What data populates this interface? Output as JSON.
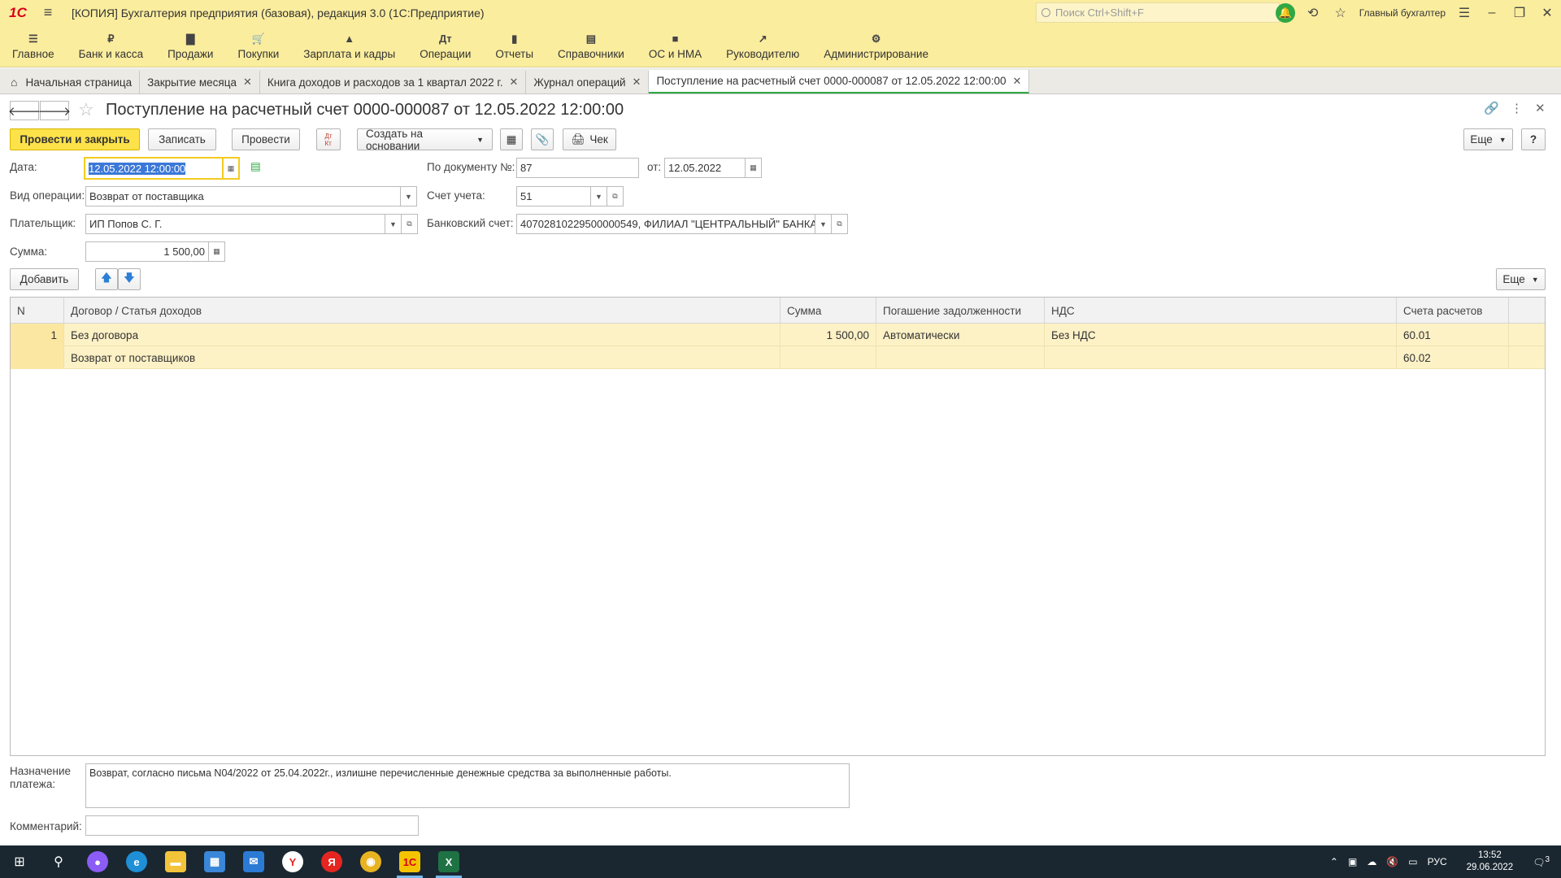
{
  "titlebar": {
    "logo": "1С",
    "title": "[КОПИЯ] Бухгалтерия предприятия (базовая), редакция 3.0  (1С:Предприятие)",
    "search_placeholder": "Поиск Ctrl+Shift+F",
    "user": "Главный бухгалтер"
  },
  "mainmenu": [
    {
      "label": "Главное",
      "icon": "menu-icon",
      "glyph": "☰"
    },
    {
      "label": "Банк и касса",
      "icon": "ruble-icon",
      "glyph": "₽"
    },
    {
      "label": "Продажи",
      "icon": "bag-icon",
      "glyph": "▇"
    },
    {
      "label": "Покупки",
      "icon": "cart-icon",
      "glyph": "🛒"
    },
    {
      "label": "Зарплата и кадры",
      "icon": "person-icon",
      "glyph": "▲"
    },
    {
      "label": "Операции",
      "icon": "dt-kt-icon",
      "glyph": "Дт"
    },
    {
      "label": "Отчеты",
      "icon": "bar-chart-icon",
      "glyph": "▮"
    },
    {
      "label": "Справочники",
      "icon": "books-icon",
      "glyph": "▤"
    },
    {
      "label": "ОС и НМА",
      "icon": "truck-icon",
      "glyph": "■"
    },
    {
      "label": "Руководителю",
      "icon": "trend-icon",
      "glyph": "↗"
    },
    {
      "label": "Администрирование",
      "icon": "gear-icon",
      "glyph": "⚙"
    }
  ],
  "tabs": [
    {
      "label": "Начальная страница",
      "closable": false
    },
    {
      "label": "Закрытие месяца",
      "closable": true
    },
    {
      "label": "Книга доходов и расходов за 1 квартал 2022 г.",
      "closable": true
    },
    {
      "label": "Журнал операций",
      "closable": true
    },
    {
      "label": "Поступление на расчетный счет 0000-000087 от 12.05.2022 12:00:00",
      "closable": true,
      "active": true
    }
  ],
  "form": {
    "title": "Поступление на расчетный счет 0000-000087 от 12.05.2022 12:00:00",
    "toolbar": {
      "post_close": "Провести и закрыть",
      "save": "Записать",
      "post": "Провести",
      "create_based": "Создать на основании",
      "check": "Чек",
      "more": "Еще",
      "help": "?"
    },
    "fields": {
      "date_label": "Дата:",
      "date_value": "12.05.2022 12:00:00",
      "doc_no_label": "По документу №:",
      "doc_no_value": "87",
      "from_label": "от:",
      "from_value": "12.05.2022",
      "op_type_label": "Вид операции:",
      "op_type_value": "Возврат от поставщика",
      "account_label": "Счет учета:",
      "account_value": "51",
      "payer_label": "Плательщик:",
      "payer_value": "ИП Попов С. Г.",
      "bank_account_label": "Банковский счет:",
      "bank_account_value": "40702810229500000549, ФИЛИАЛ \"ЦЕНТРАЛЬНЫЙ\" БАНКА",
      "sum_label": "Сумма:",
      "sum_value": "1 500,00"
    },
    "table_toolbar": {
      "add": "Добавить",
      "more": "Еще"
    },
    "table": {
      "columns": [
        "N",
        "Договор / Статья доходов",
        "Сумма",
        "Погашение задолженности",
        "НДС",
        "Счета расчетов"
      ],
      "rows": [
        {
          "n": "1",
          "contract": "Без договора",
          "article": "Возврат от поставщиков",
          "sum": "1 500,00",
          "repayment": "Автоматически",
          "vat": "Без НДС",
          "account1": "60.01",
          "account2": "60.02"
        }
      ]
    },
    "purpose_label": "Назначение платежа:",
    "purpose_value": "Возврат, согласно письма N04/2022 от 25.04.2022г., излишне перечисленные денежные средства за выполненные работы.",
    "comment_label": "Комментарий:",
    "comment_value": ""
  },
  "taskbar": {
    "lang": "РУС",
    "time": "13:52",
    "date": "29.06.2022",
    "notifications": "3"
  }
}
